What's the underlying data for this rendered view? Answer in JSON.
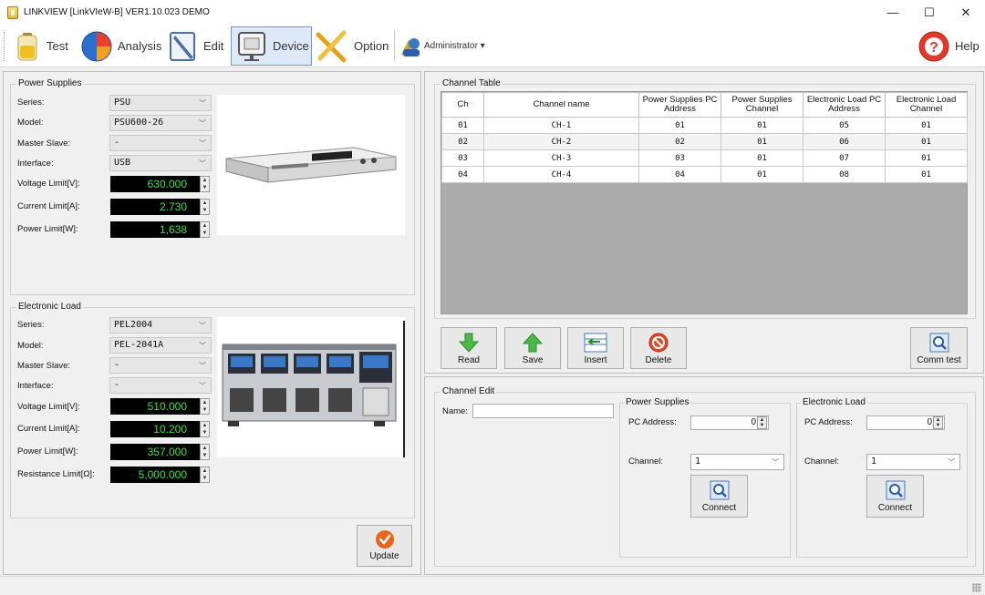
{
  "window": {
    "title": "LINKVIEW [LinkVIeW-B] VER1.10.023 DEMO",
    "minimize": "—",
    "maximize": "☐",
    "close": "✕"
  },
  "toolbar": {
    "test": "Test",
    "analysis": "Analysis",
    "edit": "Edit",
    "device": "Device",
    "option": "Option",
    "user": "Administrator ▾",
    "help": "Help"
  },
  "power_supplies": {
    "title": "Power Supplies",
    "series_label": "Series:",
    "series_value": "PSU",
    "model_label": "Model:",
    "model_value": "PSU600-26",
    "master_slave_label": "Master Slave:",
    "master_slave_value": "-",
    "interface_label": "Interface:",
    "interface_value": "USB",
    "voltage_label": "Voltage Limit[V]:",
    "voltage_value": "630.000",
    "current_label": "Current Limit[A]:",
    "current_value": "2.730",
    "power_label": "Power Limit[W]:",
    "power_value": "1,638"
  },
  "electronic_load": {
    "title": "Electronic Load",
    "series_label": "Series:",
    "series_value": "PEL2004",
    "model_label": "Model:",
    "model_value": "PEL-2041A",
    "master_slave_label": "Master Slave:",
    "master_slave_value": "-",
    "interface_label": "Interface:",
    "interface_value": "-",
    "voltage_label": "Voltage Limit[V]:",
    "voltage_value": "510.000",
    "current_label": "Current Limit[A]:",
    "current_value": "10.200",
    "power_label": "Power Limit[W]:",
    "power_value": "357.000",
    "resistance_label": "Resistance Limit[Ω]:",
    "resistance_value": "5,000.000"
  },
  "update_button": "Update",
  "channel_table": {
    "title": "Channel Table",
    "headers": {
      "ch": "Ch",
      "name": "Channel name",
      "ps_addr": "Power Supplies PC Address",
      "ps_ch": "Power Supplies Channel",
      "el_addr": "Electronic Load PC Address",
      "el_ch": "Electronic Load Channel"
    },
    "rows": [
      {
        "ch": "01",
        "name": "CH-1",
        "ps_addr": "01",
        "ps_ch": "01",
        "el_addr": "05",
        "el_ch": "01"
      },
      {
        "ch": "02",
        "name": "CH-2",
        "ps_addr": "02",
        "ps_ch": "01",
        "el_addr": "06",
        "el_ch": "01"
      },
      {
        "ch": "03",
        "name": "CH-3",
        "ps_addr": "03",
        "ps_ch": "01",
        "el_addr": "07",
        "el_ch": "01"
      },
      {
        "ch": "04",
        "name": "CH-4",
        "ps_addr": "04",
        "ps_ch": "01",
        "el_addr": "08",
        "el_ch": "01"
      }
    ],
    "buttons": {
      "read": "Read",
      "save": "Save",
      "insert": "Insert",
      "delete": "Delete",
      "comm_test": "Comm test"
    }
  },
  "channel_edit": {
    "title": "Channel Edit",
    "name_label": "Name:",
    "name_value": "",
    "ps": {
      "title": "Power Supplies",
      "pc_address_label": "PC Address:",
      "pc_address_value": "0",
      "channel_label": "Channel:",
      "channel_value": "1",
      "connect": "Connect"
    },
    "el": {
      "title": "Electronic Load",
      "pc_address_label": "PC Address:",
      "pc_address_value": "0",
      "channel_label": "Channel:",
      "channel_value": "1",
      "connect": "Connect"
    }
  }
}
